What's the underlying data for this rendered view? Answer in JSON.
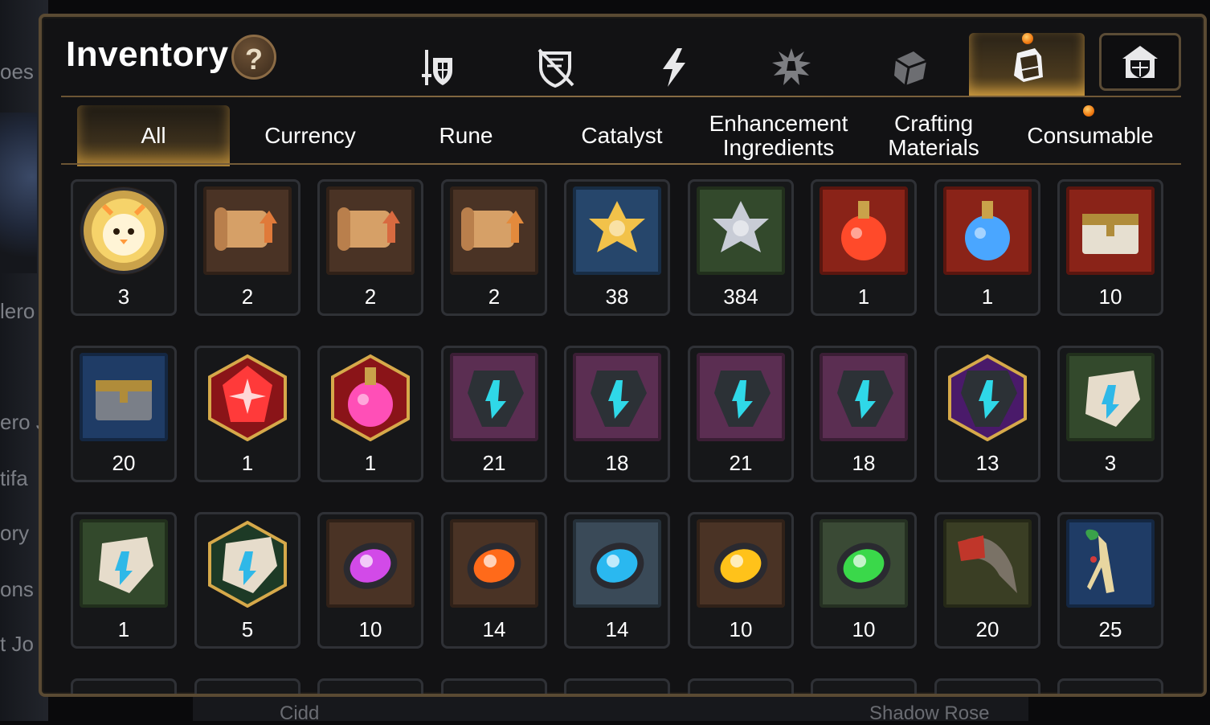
{
  "background": {
    "left_texts": [
      "oes",
      "lero",
      "ero J",
      "tifa",
      "ory",
      "ons",
      "t Jo"
    ],
    "bottom_texts": [
      "Cidd",
      "Shadow Rose"
    ]
  },
  "header": {
    "title": "Inventory",
    "help_label": "?"
  },
  "top_tabs": [
    {
      "icon": "sword-shield-icon"
    },
    {
      "icon": "broken-shield-icon"
    },
    {
      "icon": "lightning-icon"
    },
    {
      "icon": "burst-gear-icon"
    },
    {
      "icon": "cube-icon"
    },
    {
      "icon": "backpack-icon",
      "active": true
    },
    {
      "icon": "guild-house-icon"
    }
  ],
  "categories": [
    {
      "label": "All",
      "active": true
    },
    {
      "label": "Currency"
    },
    {
      "label": "Rune"
    },
    {
      "label": "Catalyst"
    },
    {
      "label": "Enhancement Ingredients"
    },
    {
      "label": "Crafting Materials"
    },
    {
      "label": "Consumable"
    }
  ],
  "items": [
    {
      "name": "phoenix-token",
      "count": "3",
      "frame": "circle",
      "bg": "#caa24a",
      "color": "#ff9a3c"
    },
    {
      "name": "scroll-fire",
      "count": "2",
      "frame": "square",
      "bg": "#4a3325",
      "color": "#e07a3a"
    },
    {
      "name": "scroll-rainbow",
      "count": "2",
      "frame": "square",
      "bg": "#4a3325",
      "color": "#d86a40"
    },
    {
      "name": "scroll-gold",
      "count": "2",
      "frame": "square",
      "bg": "#4a3325",
      "color": "#e38a3c"
    },
    {
      "name": "gold-flower",
      "count": "38",
      "frame": "square",
      "bg": "#26466b",
      "color": "#f2c24a"
    },
    {
      "name": "silver-flower",
      "count": "384",
      "frame": "square",
      "bg": "#33492c",
      "color": "#c8ccd6"
    },
    {
      "name": "red-potion",
      "count": "1",
      "frame": "square",
      "bg": "#8a2318",
      "color": "#ff4a2a"
    },
    {
      "name": "star-potion",
      "count": "1",
      "frame": "square",
      "bg": "#8a2318",
      "color": "#4aa6ff"
    },
    {
      "name": "chest-red",
      "count": "10",
      "frame": "square",
      "bg": "#8a2318",
      "color": "#e6dfd0"
    },
    {
      "name": "dark-chest",
      "count": "20",
      "frame": "square",
      "bg": "#1f3c66",
      "color": "#7a7f88"
    },
    {
      "name": "red-gem-hex",
      "count": "1",
      "frame": "hex",
      "bg": "#8a1418",
      "color": "#ff3a3a"
    },
    {
      "name": "pink-potion-hex",
      "count": "1",
      "frame": "hex",
      "bg": "#8a1418",
      "color": "#ff4fb7"
    },
    {
      "name": "rune-stone-sword",
      "count": "21",
      "frame": "square",
      "bg": "#5b2e52",
      "color": "#2fd8e8"
    },
    {
      "name": "rune-stone-swirl",
      "count": "18",
      "frame": "square",
      "bg": "#5b2e52",
      "color": "#2fd8e8"
    },
    {
      "name": "rune-stone-armor",
      "count": "21",
      "frame": "square",
      "bg": "#5b2e52",
      "color": "#2fd8e8"
    },
    {
      "name": "rune-stone-boot",
      "count": "18",
      "frame": "square",
      "bg": "#5b2e52",
      "color": "#2fd8e8"
    },
    {
      "name": "rune-stone-star-hex",
      "count": "13",
      "frame": "hex",
      "bg": "#4a1a6a",
      "color": "#2fd8e8"
    },
    {
      "name": "bone-stone-sword",
      "count": "3",
      "frame": "square",
      "bg": "#33492c",
      "color": "#2fb8e8"
    },
    {
      "name": "bone-stone-swirl",
      "count": "1",
      "frame": "square",
      "bg": "#33492c",
      "color": "#2fb8e8"
    },
    {
      "name": "bone-stone-star-hex",
      "count": "5",
      "frame": "hex",
      "bg": "#1d3a26",
      "color": "#2fb8e8"
    },
    {
      "name": "purple-orb",
      "count": "10",
      "frame": "square",
      "bg": "#4a3325",
      "color": "#d24ae8"
    },
    {
      "name": "orange-orb",
      "count": "14",
      "frame": "square",
      "bg": "#4a3325",
      "color": "#ff6a1a"
    },
    {
      "name": "blue-orb",
      "count": "14",
      "frame": "square",
      "bg": "#3a4a58",
      "color": "#2ab8f0"
    },
    {
      "name": "yellow-orb",
      "count": "10",
      "frame": "square",
      "bg": "#4a3325",
      "color": "#ffc21a"
    },
    {
      "name": "green-orb",
      "count": "10",
      "frame": "square",
      "bg": "#3a4a35",
      "color": "#3ad84a"
    },
    {
      "name": "red-claw",
      "count": "20",
      "frame": "square",
      "bg": "#3a3e24",
      "color": "#c0362a"
    },
    {
      "name": "ginseng-root",
      "count": "25",
      "frame": "square",
      "bg": "#1f3c66",
      "color": "#e8d6a0"
    }
  ],
  "colors": {
    "panel_border": "#5a4a33",
    "accent_gold": "#8a6a2a",
    "notification": "#f07a12"
  }
}
